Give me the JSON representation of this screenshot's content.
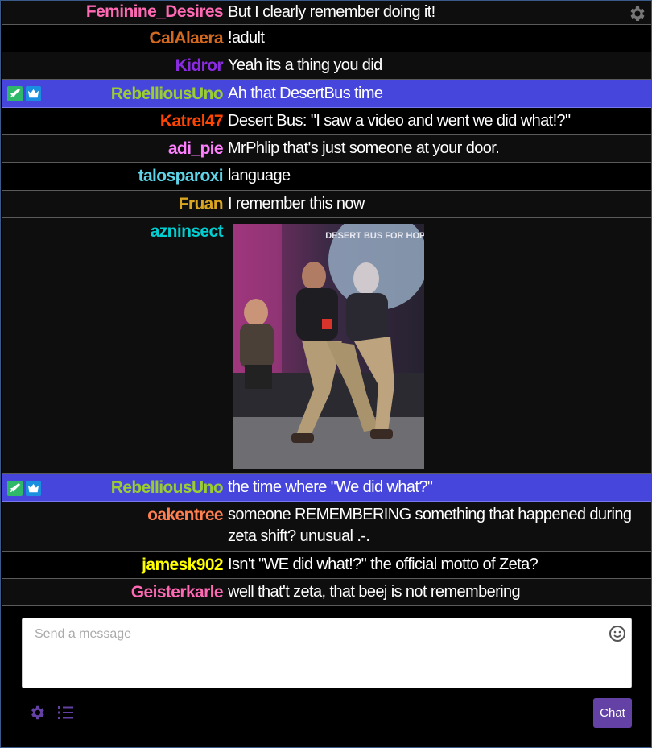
{
  "messages": [
    {
      "user": "Feminine_Desires",
      "color": "#ff69b4",
      "text": "But I clearly remember doing it!"
    },
    {
      "user": "CalAlaera",
      "color": "#d2691e",
      "text": "!adult"
    },
    {
      "user": "Kidror",
      "color": "#8a2be2",
      "text": "Yeah its a thing you did"
    },
    {
      "user": "RebelliousUno",
      "color": "#9acd32",
      "text": "Ah that DesertBus time",
      "badges": [
        "moderator-icon",
        "subscriber-crown-icon"
      ],
      "highlighted": true
    },
    {
      "user": "Katrel47",
      "color": "#ff4500",
      "text": "Desert Bus: \"I saw a video and went we did what!?\""
    },
    {
      "user": "adi_pie",
      "color": "#ff7fff",
      "text": "MrPhlip that's just someone at your door."
    },
    {
      "user": "talosparoxi",
      "color": "#5fd4e8",
      "text": "language"
    },
    {
      "user": "Fruan",
      "color": "#daa520",
      "text": "I remember this now"
    },
    {
      "user": "azninsect",
      "color": "#00ced1",
      "image": "desert-bus-gif",
      "image_text": "DESERT BUS FOR HOPE"
    },
    {
      "user": "RebelliousUno",
      "color": "#9acd32",
      "text": "the time where \"We did what?\"",
      "badges": [
        "moderator-icon",
        "subscriber-crown-icon"
      ],
      "highlighted": true
    },
    {
      "user": "oakentree",
      "color": "#ff7f50",
      "text": "someone REMEMBERING something that happened during zeta shift? unusual .-."
    },
    {
      "user": "jamesk902",
      "color": "#ffff00",
      "text": "Isn't \"WE did what!?\" the official motto of Zeta?"
    },
    {
      "user": "Geisterkarle",
      "color": "#ff69b4",
      "text": "well that't zeta, that beej is not remembering"
    }
  ],
  "composer": {
    "placeholder": "Send a message"
  },
  "chat_button_label": "Chat",
  "icons": {
    "settings": "gear-icon",
    "user_list": "list-icon",
    "emoji": "emoji-icon"
  },
  "colors": {
    "highlight": "#4646dc",
    "button": "#6441a5",
    "icon": "#6441a5"
  }
}
